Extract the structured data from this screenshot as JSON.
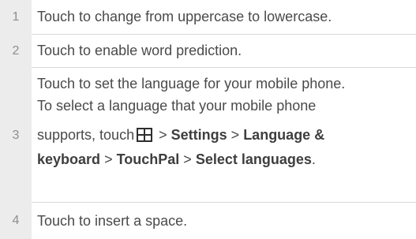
{
  "rows": [
    {
      "num": "1",
      "text": "Touch to change from uppercase to lowercase."
    },
    {
      "num": "2",
      "text": "Touch to enable word prediction."
    },
    {
      "num": "3",
      "line1": "Touch to set the language for your mobile phone.",
      "line2": "To select a language that your mobile phone",
      "line3_pre": "supports, touch",
      "icon": "grid-menu-icon",
      "sep": ">",
      "settings": "Settings",
      "lang_kb": "Language &",
      "keyboard": "keyboard",
      "touchpal": "TouchPal",
      "select_langs": "Select languages",
      "period": "."
    },
    {
      "num": "4",
      "text": "Touch to insert a space."
    }
  ]
}
